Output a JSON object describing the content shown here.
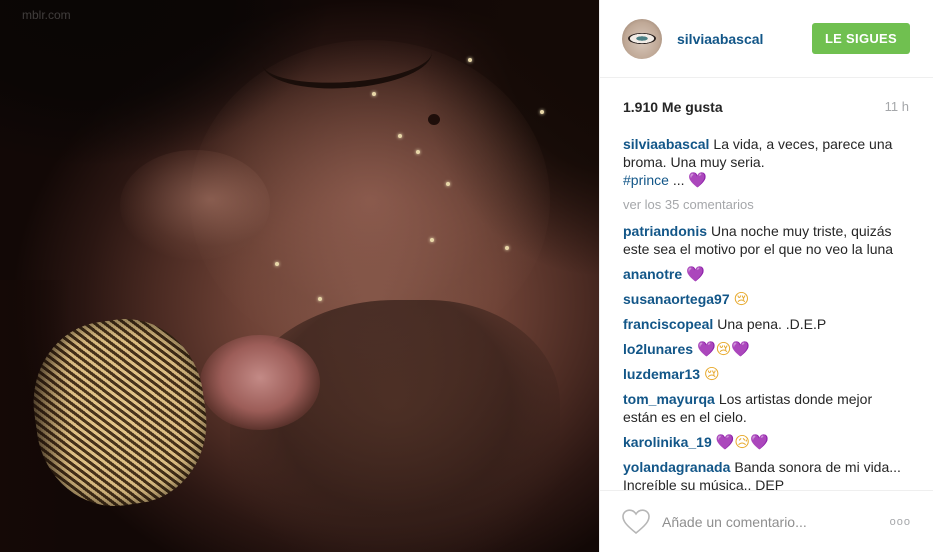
{
  "photo": {
    "watermark": "mblr.com"
  },
  "header": {
    "username": "silviaabascal",
    "follow_label": "LE SIGUES"
  },
  "stats": {
    "likes": "1.910 Me gusta",
    "time": "11 h"
  },
  "caption": {
    "user": "silviaabascal",
    "text": "La vida, a veces, parece una broma. Una muy seria.",
    "hashtag": "#prince",
    "ellipsis": "..."
  },
  "view_more": "ver los 35 comentarios",
  "comments": [
    {
      "user": "patriandonis",
      "text": "Una noche muy triste, quizás este sea el motivo por el que no veo la luna"
    },
    {
      "user": "ananotre",
      "text": "",
      "emojis": [
        "heart"
      ]
    },
    {
      "user": "susanaortega97",
      "text": "",
      "emojis": [
        "cry"
      ]
    },
    {
      "user": "franciscopeal",
      "text": "Una pena. .D.E.P"
    },
    {
      "user": "lo2lunares",
      "text": "",
      "emojis": [
        "heart",
        "cry",
        "heart"
      ]
    },
    {
      "user": "luzdemar13",
      "text": "",
      "emojis": [
        "cry"
      ]
    },
    {
      "user": "tom_mayurqa",
      "text": "Los artistas donde mejor están es en el cielo."
    },
    {
      "user": "karolinika_19",
      "text": "",
      "emojis": [
        "heart",
        "sad",
        "heart"
      ]
    },
    {
      "user": "yolandagranada",
      "text": "Banda sonora de mi vida... Increíble su música.. DEP"
    }
  ],
  "footer": {
    "placeholder": "Añade un comentario...",
    "options": "ooo"
  },
  "icons": {
    "like": "heart-outline-icon",
    "options": "more-options-icon",
    "heart_emoji": "purple-heart-emoji",
    "cry_emoji": "crying-face-emoji"
  },
  "colors": {
    "link": "#125688",
    "follow": "#70c050",
    "muted": "#a5a7aa",
    "heart_emoji": "#a23fd8"
  }
}
